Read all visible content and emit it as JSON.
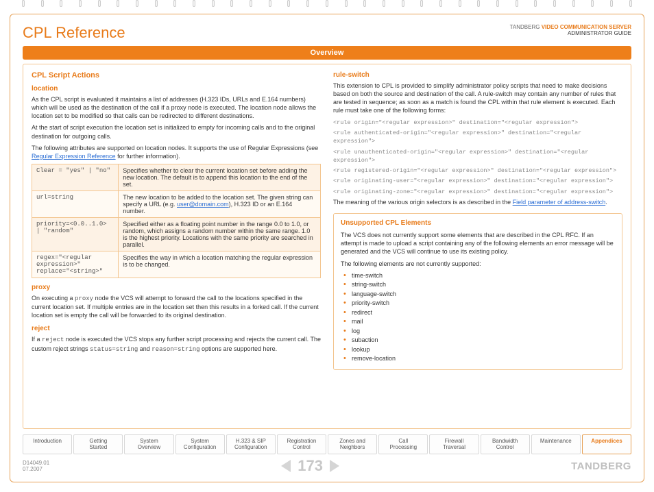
{
  "header": {
    "title": "CPL Reference",
    "product_prefix": "TANDBERG",
    "product_name": "VIDEO COMMUNICATION SERVER",
    "subtitle": "ADMINISTRATOR GUIDE"
  },
  "overview_label": "Overview",
  "left": {
    "section_title": "CPL Script Actions",
    "location_h": "location",
    "loc_p1": "As the CPL script is evaluated it maintains a list of addresses (H.323 IDs, URLs and E.164 numbers) which will be used as the destination of the call if a proxy node is executed. The location node allows the location set to be modified so that calls can be redirected to different destinations.",
    "loc_p2": "At the start of script execution the location set is initialized to empty for incoming calls and to the original destination for outgoing calls.",
    "loc_p3_a": "The following attributes are supported on location nodes. It supports the use of Regular Expressions (see ",
    "loc_p3_link": "Regular Expression Reference",
    "loc_p3_b": " for further information).",
    "attrs": [
      {
        "k": "Clear = \"yes\" | \"no\"",
        "v": "Specifies whether to clear the current location set before adding the new location. The default is to append this location to the end of the set."
      },
      {
        "k": "url=string",
        "v_a": "The new location to be added to the location set. The given string can specify a URL (e.g. ",
        "v_link": "user@domain.com",
        "v_b": "), H.323 ID or an E.164 number."
      },
      {
        "k": "priority=<0.0..1.0> | \"random\"",
        "v": "Specified either as a floating point number in the range 0.0 to 1.0, or random, which assigns a random number within the same range. 1.0 is the highest priority.  Locations with the same priority are searched in parallel."
      },
      {
        "k": "regex=\"<regular expression>\" replace=\"<string>\"",
        "v": "Specifies the way in which a location matching the regular expression is to be changed."
      }
    ],
    "proxy_h": "proxy",
    "proxy_p": "On executing a proxy node the VCS will attempt to forward the call to the locations specified in the current location set. If multiple entries are in the location set then this results in a forked call. If the current location set is empty the call will be forwarded to its original destination.",
    "reject_h": "reject",
    "reject_p_a": "If a ",
    "reject_code1": "reject",
    "reject_p_b": " node is executed the VCS stops any further script processing and rejects the current call. The custom reject strings ",
    "reject_code2": "status=string",
    "reject_p_c": " and ",
    "reject_code3": "reason=string",
    "reject_p_d": " options are supported here."
  },
  "right": {
    "rule_h": "rule-switch",
    "rule_p1": "This extension to CPL is provided to simplify administrator policy scripts that need to make decisions based on both the source and destination of the call. A rule-switch may contain any number of rules that are tested in sequence; as soon as a match is found the CPL within that rule element is executed. Each rule must take one of the following forms:",
    "rules": [
      "<rule origin=\"<regular expression>\" destination=\"<regular expression\">",
      "<rule authenticated-origin=\"<regular expression>\" destination=\"<regular expression\">",
      "<rule unauthenticated-origin=\"<regular expression>\" destination=\"<regular expression\">",
      "<rule registered-origin=\"<regular expression>\" destination=\"<regular expression\">",
      "<rule originating-user=\"<regular expression>\" destination=\"<regular expression\">",
      "<rule originating-zone=\"<regular expression>\" destination=\"<regular expression\">"
    ],
    "rule_p2_a": "The meaning of the various origin selectors is as described in the ",
    "rule_link": "Field parameter of address-switch",
    "rule_p2_b": ".",
    "unsup_h": "Unsupported CPL Elements",
    "unsup_p1": "The VCS does not currently support some elements that are described in the CPL RFC. If an attempt is made to upload a script containing any of the following elements an error message will be generated and the VCS will continue to use its existing policy.",
    "unsup_p2": "The following elements are not currently supported:",
    "unsup_list": [
      "time-switch",
      "string-switch",
      "language-switch",
      "priority-switch",
      "redirect",
      "mail",
      "log",
      "subaction",
      "lookup",
      "remove-location"
    ]
  },
  "tabs": [
    "Introduction",
    "Getting\nStarted",
    "System\nOverview",
    "System\nConfiguration",
    "H.323 & SIP\nConfiguration",
    "Registration\nControl",
    "Zones and\nNeighbors",
    "Call\nProcessing",
    "Firewall\nTraversal",
    "Bandwidth\nControl",
    "Maintenance",
    "Appendices"
  ],
  "active_tab_index": 11,
  "footer": {
    "doc_id": "D14049.01",
    "date": "07.2007",
    "page": "173",
    "brand": "TANDBERG"
  }
}
